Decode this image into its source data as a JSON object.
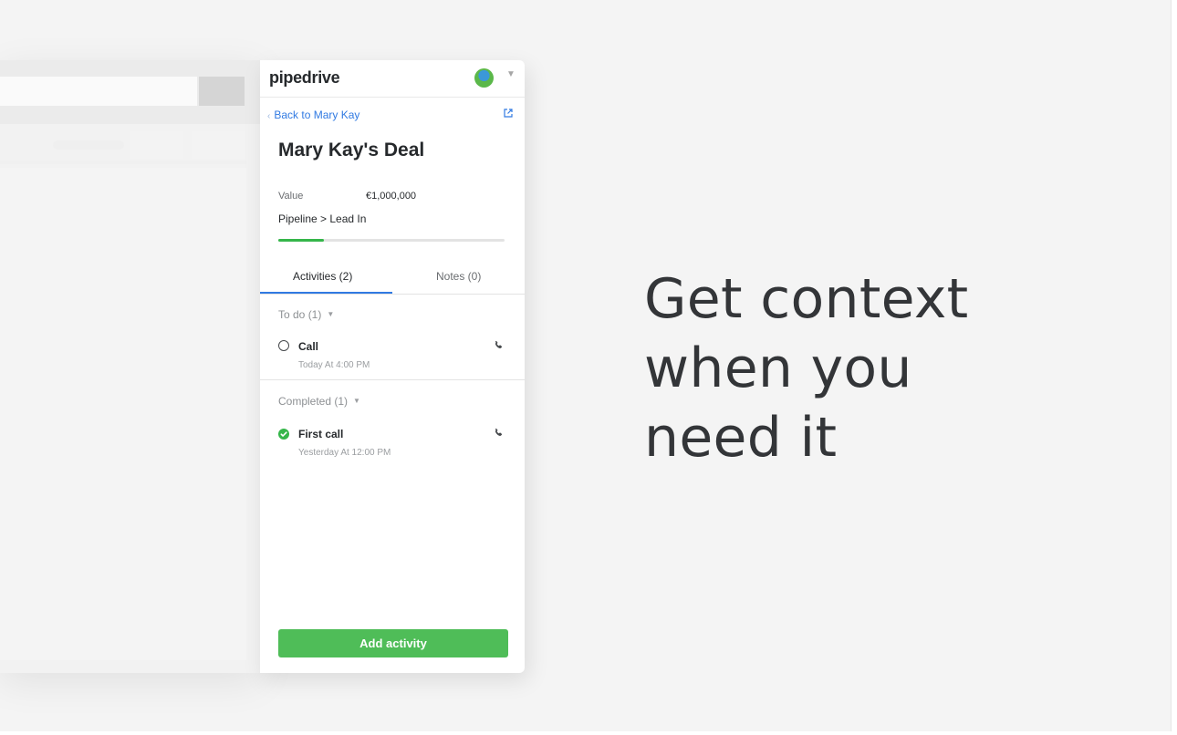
{
  "sidebar": {
    "logo": "pipedrive",
    "back_link": "Back to Mary Kay",
    "deal_title": "Mary Kay's Deal",
    "value_label": "Value",
    "value_amount": "€1,000,000",
    "pipeline": "Pipeline > Lead In",
    "pipeline_progress": 0.2,
    "tabs": [
      {
        "label": "Activities (2)",
        "active": true
      },
      {
        "label": "Notes (0)",
        "active": false
      }
    ],
    "todo": {
      "header": "To do (1)",
      "items": [
        {
          "title": "Call",
          "time": "Today At 4:00 PM",
          "icon": "phone-icon",
          "done": false
        }
      ]
    },
    "completed": {
      "header": "Completed (1)",
      "items": [
        {
          "title": "First call",
          "time": "Yesterday At 12:00 PM",
          "icon": "phone-icon",
          "done": true
        }
      ]
    },
    "add_button": "Add activity"
  },
  "tagline": {
    "lines": [
      "Get context",
      "when you",
      "need it"
    ]
  },
  "colors": {
    "accent_blue": "#317ae2",
    "brand_green": "#4fbd58",
    "check_green": "#35b64a",
    "text_dark": "#26292c"
  }
}
